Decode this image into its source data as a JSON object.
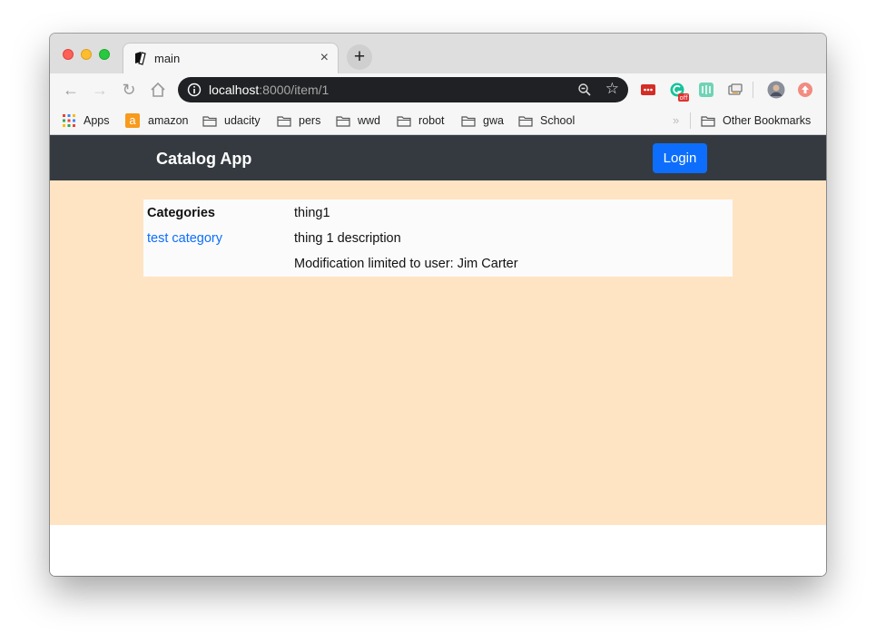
{
  "browser": {
    "tab": {
      "title": "main",
      "close_glyph": "×"
    },
    "new_tab_glyph": "+",
    "nav": {
      "back_glyph": "←",
      "forward_glyph": "→",
      "reload_glyph": "↻",
      "home_icon": "home-icon"
    },
    "address": {
      "host": "localhost",
      "rest": ":8000/item/1"
    },
    "extensions": [
      "lastpass-icon",
      "grammarly-icon",
      "extension-green-icon",
      "cast-icon",
      "profile-avatar",
      "update-icon"
    ],
    "extension_badge": "off",
    "bookmarks": {
      "items": [
        {
          "label": "Apps",
          "icon": "apps-grid-icon"
        },
        {
          "label": "amazon",
          "icon": "amazon-icon",
          "icon_letter": "a"
        },
        {
          "label": "udacity",
          "icon": "folder-icon"
        },
        {
          "label": "pers",
          "icon": "folder-icon"
        },
        {
          "label": "wwd",
          "icon": "folder-icon"
        },
        {
          "label": "robot",
          "icon": "folder-icon"
        },
        {
          "label": "gwa",
          "icon": "folder-icon"
        },
        {
          "label": "School",
          "icon": "folder-icon"
        }
      ],
      "overflow_glyph": "»",
      "other": "Other Bookmarks"
    }
  },
  "app": {
    "brand": "Catalog App",
    "login_label": "Login",
    "colors": {
      "navbar": "#343a40",
      "accent": "#0d6efd",
      "content_bg": "#ffe4c4"
    },
    "categories_header": "Categories",
    "categories": [
      "test category"
    ],
    "item": {
      "name": "thing1",
      "description": "thing 1 description",
      "owner_note": "Modification limited to user: Jim Carter"
    }
  }
}
